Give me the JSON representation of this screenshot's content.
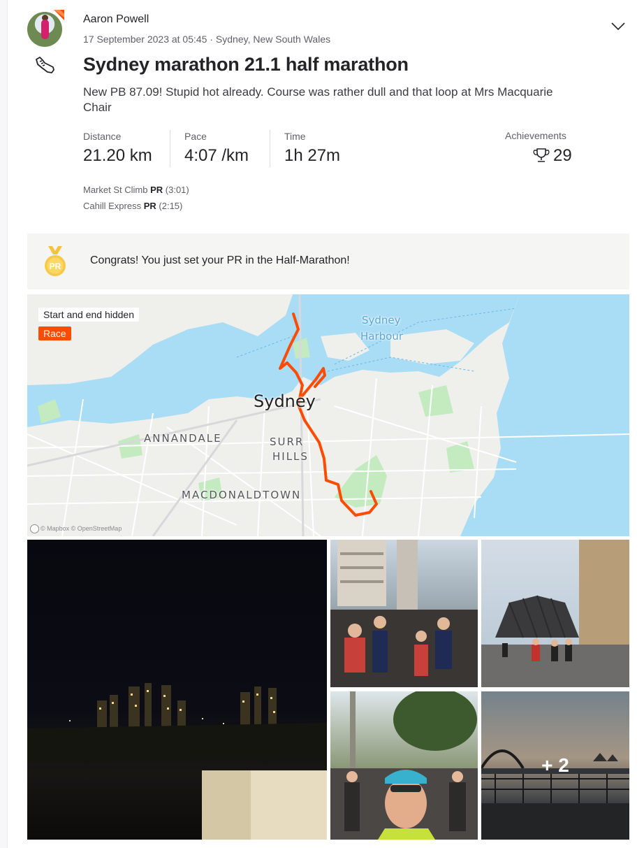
{
  "athlete": {
    "name": "Aaron Powell",
    "avatar_icon": "avatar-runner-photo"
  },
  "activity": {
    "datetime": "17 September 2023 at 05:45",
    "location": "Sydney, New South Wales",
    "title": "Sydney marathon 21.1 half marathon",
    "description": "New PB 87.09! Stupid hot already. Course was rather dull and that loop at Mrs Macquarie Chair",
    "sport_icon": "running-shoe-icon"
  },
  "stats": [
    {
      "label": "Distance",
      "value": "21.20 km"
    },
    {
      "label": "Pace",
      "value": "4:07 /km"
    },
    {
      "label": "Time",
      "value": "1h 27m"
    }
  ],
  "achievements": {
    "label": "Achievements",
    "value": "29",
    "icon": "trophy-icon"
  },
  "segments": [
    {
      "name": "Market St Climb",
      "badge": "PR",
      "time": "(3:01)"
    },
    {
      "name": "Cahill Express",
      "badge": "PR",
      "time": "(2:15)"
    }
  ],
  "congrats": {
    "text": "Congrats! You just set your PR in the Half-Marathon!",
    "badge_text": "PR"
  },
  "map": {
    "pill_hidden": "Start and end hidden",
    "pill_race": "Race",
    "labels": {
      "city": "Sydney",
      "harbour_1": "Sydney",
      "harbour_2": "Harbour",
      "annandale": "ANNANDALE",
      "surry_1": "SURR",
      "surry_2": "HILLS",
      "macdonaldtown": "MACDONALDTOWN"
    },
    "attribution": "© Mapbox © OpenStreetMap"
  },
  "photos": {
    "more_count": "+ 2"
  },
  "colors": {
    "brand": "#fc4c02",
    "route": "#fc4c02",
    "water": "#a9dcf5",
    "park": "#c4ebc0"
  }
}
